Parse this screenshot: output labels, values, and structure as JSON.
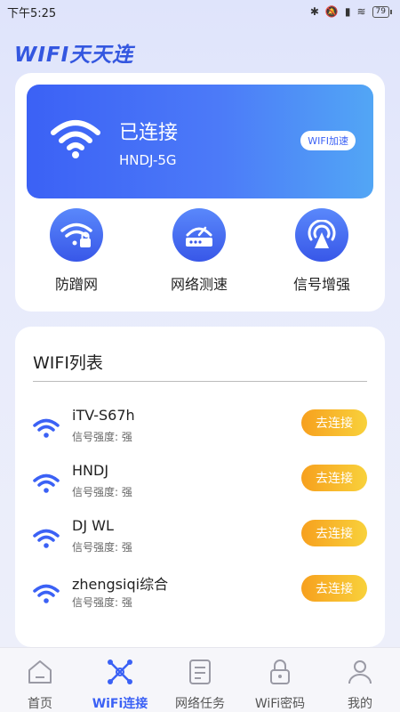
{
  "status_bar": {
    "time": "下午5:25",
    "battery": "79"
  },
  "app": {
    "title": "WIFI天天连"
  },
  "connection": {
    "status": "已连接",
    "ssid": "HNDJ-5G",
    "boost_label": "WIFI加速"
  },
  "features": [
    {
      "label": "防蹭网",
      "icon": "wifi-lock-icon"
    },
    {
      "label": "网络测速",
      "icon": "router-speed-icon"
    },
    {
      "label": "信号增强",
      "icon": "signal-boost-icon"
    }
  ],
  "wifi_list": {
    "title": "WIFI列表",
    "connect_label": "去连接",
    "items": [
      {
        "name": "iTV-S67h",
        "strength": "信号强度: 强"
      },
      {
        "name": "HNDJ",
        "strength": "信号强度: 强"
      },
      {
        "name": "DJ WL",
        "strength": "信号强度: 强"
      },
      {
        "name": "zhengsiqi综合",
        "strength": "信号强度: 强"
      }
    ]
  },
  "nav": [
    {
      "label": "首页",
      "icon": "home-icon",
      "active": false
    },
    {
      "label": "WiFi连接",
      "icon": "wifi-connect-icon",
      "active": true
    },
    {
      "label": "网络任务",
      "icon": "task-list-icon",
      "active": false
    },
    {
      "label": "WiFi密码",
      "icon": "lock-icon",
      "active": false
    },
    {
      "label": "我的",
      "icon": "user-icon",
      "active": false
    }
  ],
  "colors": {
    "primary": "#3b61f5",
    "accent_orange": "#f7a01e",
    "accent_yellow": "#f8d13b"
  }
}
